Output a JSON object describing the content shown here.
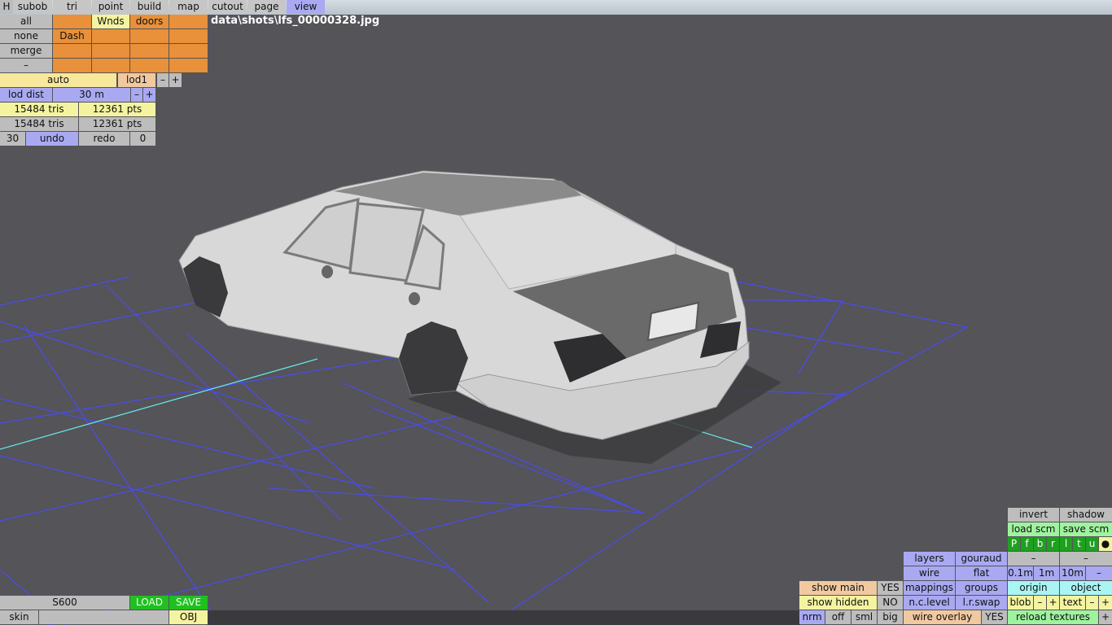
{
  "tabs": {
    "h": "H",
    "items": [
      "subob",
      "tri",
      "point",
      "build",
      "map",
      "cutout",
      "page",
      "view"
    ],
    "active": "view"
  },
  "file_path": "data\\shots\\lfs_00000328.jpg",
  "groups": {
    "all": "all",
    "none": "none",
    "merge": "merge",
    "dash_row": "–",
    "wnds": "Wnds",
    "doors": "doors",
    "dash": "Dash"
  },
  "lod": {
    "auto": "auto",
    "lod1": "lod1",
    "minus": "–",
    "plus": "+",
    "lod_dist_label": "lod dist",
    "lod_dist_value": "30 m"
  },
  "stats": {
    "tris_1": "15484 tris",
    "pts_1": "12361 pts",
    "tris_2": "15484 tris",
    "pts_2": "12361 pts"
  },
  "history": {
    "count": "30",
    "undo": "undo",
    "redo": "redo",
    "redo_count": "0"
  },
  "bottom_left": {
    "model_name": "S600",
    "load": "LOAD",
    "save": "SAVE",
    "skin": "skin",
    "obj": "OBJ"
  },
  "bottom_right": {
    "invert": "invert",
    "shadow": "shadow",
    "load_scm": "load scm",
    "save_scm": "save scm",
    "view_letters": [
      "P",
      "f",
      "b",
      "r",
      "l",
      "t",
      "u",
      "●"
    ],
    "dash": "–",
    "layers": "layers",
    "gouraud": "gouraud",
    "wire": "wire",
    "flat": "flat",
    "grid_01m": "0.1m",
    "grid_1m": "1m",
    "grid_10m": "10m",
    "grid_minus": "–",
    "show_main": "show main",
    "show_main_val": "YES",
    "mappings": "mappings",
    "groups": "groups",
    "origin": "origin",
    "object": "object",
    "show_hidden": "show hidden",
    "show_hidden_val": "NO",
    "nc_level": "n.c.level",
    "lr_swap": "l.r.swap",
    "blob": "blob",
    "blob_minus": "–",
    "blob_plus": "+",
    "text": "text",
    "text_minus": "–",
    "text_plus": "+",
    "nrm": "nrm",
    "off": "off",
    "sml": "sml",
    "big": "big",
    "wire_overlay": "wire overlay",
    "wire_overlay_val": "YES",
    "reload_textures": "reload textures",
    "reload_minus": "+"
  },
  "colors": {
    "viewport_bg": "#545459",
    "grid_line": "#4b4bf0",
    "axis_line": "#66e3e3",
    "car_body": "#d7d7d7"
  }
}
